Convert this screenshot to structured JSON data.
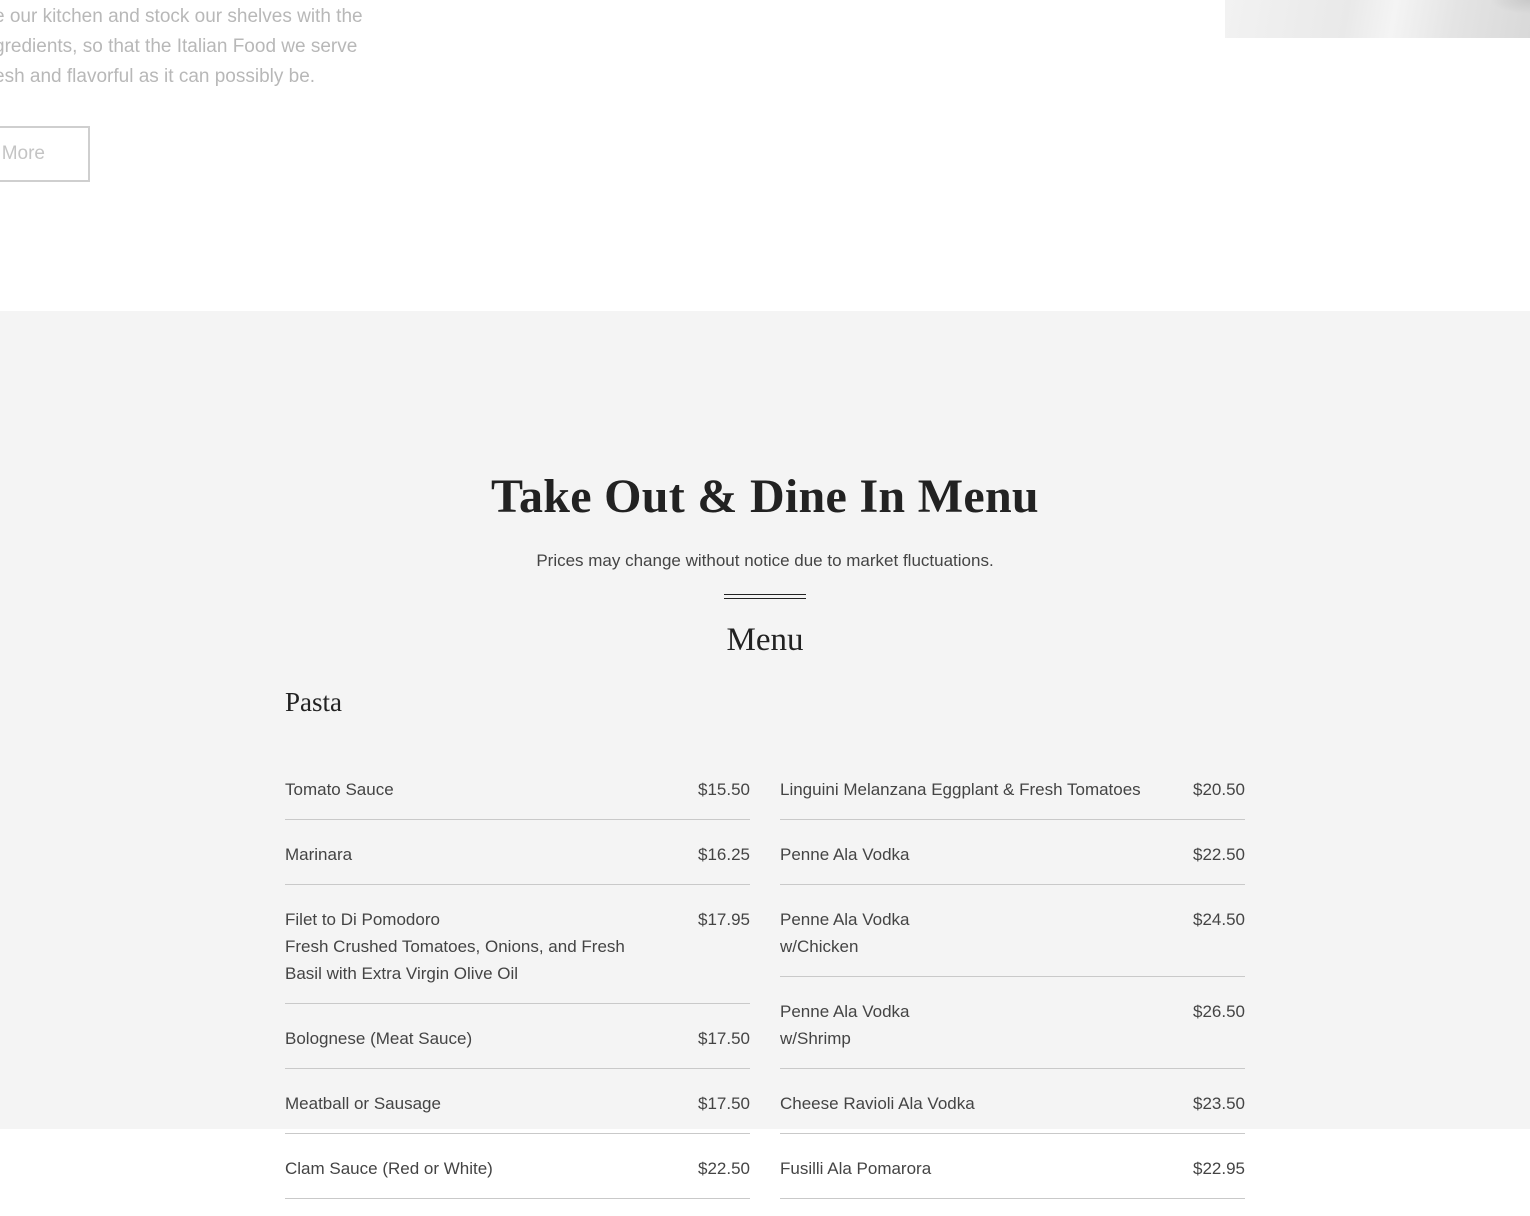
{
  "about": {
    "lines": [
      "e our kitchen and stock our shelves with the",
      "gredients, so that the Italian Food we serve",
      "esh and flavorful as it can possibly be."
    ],
    "button_label": "More"
  },
  "menu_section": {
    "heading": "Take Out & Dine In Menu",
    "subtitle": "Prices may change without notice due to market fluctuations.",
    "menu_title": "Menu",
    "category": "Pasta",
    "left_items": [
      {
        "name": "Tomato Sauce",
        "desc": "",
        "price": "$15.50"
      },
      {
        "name": "Marinara",
        "desc": "",
        "price": "$16.25"
      },
      {
        "name": "Filet to Di Pomodoro",
        "desc": "Fresh Crushed Tomatoes, Onions, and Fresh Basil with Extra Virgin Olive Oil",
        "price": "$17.95"
      },
      {
        "name": "Bolognese (Meat Sauce)",
        "desc": "",
        "price": "$17.50"
      },
      {
        "name": "Meatball or Sausage",
        "desc": "",
        "price": "$17.50"
      },
      {
        "name": "Clam Sauce (Red or White)",
        "desc": "",
        "price": "$22.50"
      }
    ],
    "right_items": [
      {
        "name": "Linguini Melanzana Eggplant & Fresh Tomatoes",
        "desc": "",
        "price": "$20.50"
      },
      {
        "name": "Penne Ala Vodka",
        "desc": "",
        "price": "$22.50"
      },
      {
        "name": "Penne Ala Vodka",
        "desc": "w/Chicken",
        "price": "$24.50"
      },
      {
        "name": "Penne Ala Vodka",
        "desc": "w/Shrimp",
        "price": "$26.50"
      },
      {
        "name": "Cheese Ravioli Ala Vodka",
        "desc": "",
        "price": "$23.50"
      },
      {
        "name": "Fusilli Ala Pomarora",
        "desc": "",
        "price": "$22.95"
      }
    ]
  }
}
